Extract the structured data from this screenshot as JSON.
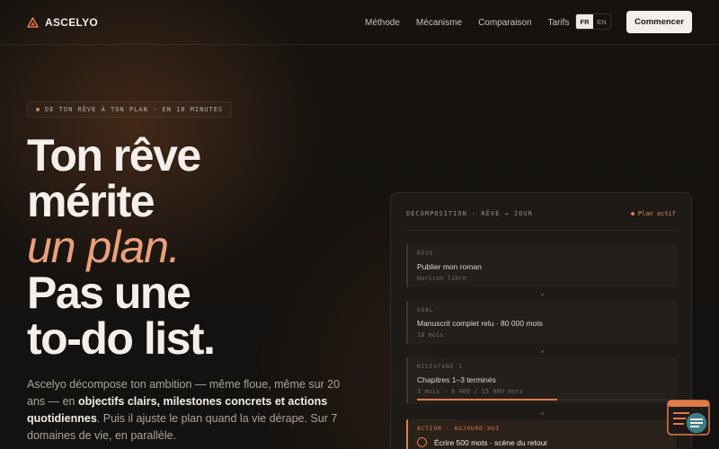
{
  "nav": {
    "brand": "ASCELYO",
    "links": [
      "Méthode",
      "Mécanisme",
      "Comparaison",
      "Tarifs"
    ],
    "lang_active": "FR",
    "lang_inactive": "EN",
    "cta": "Commencer"
  },
  "hero": {
    "badge": "DE TON RÊVE À TON PLAN · EN 10 MINUTES",
    "headline": {
      "line1": "Ton rêve",
      "line2": "mérite",
      "line3_accent": "un plan.",
      "line4": "Pas une",
      "line5": "to-do list."
    },
    "lead": {
      "part1": "Ascelyo décompose ton ambition — même floue, même sur 20 ans — en ",
      "bold": "objectifs clairs, milestones concrets et actions quotidiennes",
      "part2": ". Puis il ajuste le plan quand la vie dérape. Sur 7 domaines de vie, en parallèle."
    }
  },
  "card": {
    "title": "DÉCOMPOSITION · RÊVE → JOUR",
    "status": "Plan actif",
    "steps": [
      {
        "label": "RÊVE",
        "title": "Publier mon roman",
        "sub": "Horizon libre"
      },
      {
        "label": "GOAL",
        "title": "Manuscrit complet relu · 80 000 mots",
        "sub": "18 mois"
      },
      {
        "label": "MILESTONE 1",
        "title": "Chapitres 1–3 terminés",
        "sub": "3 mois · 8 400 / 15 000 mots",
        "progress": 0.56
      },
      {
        "label": "ACTION · AUJOURD'HUI",
        "title": "Écrire 500 mots · scène du retour"
      }
    ]
  },
  "colors": {
    "accent": "#e07b4a",
    "accent_soft": "#eaa07c",
    "background": "#141210",
    "cta_bg": "#f3efea"
  },
  "icons": {
    "logo": "triangle-logo-icon",
    "widget": "chat-widget-icon"
  }
}
